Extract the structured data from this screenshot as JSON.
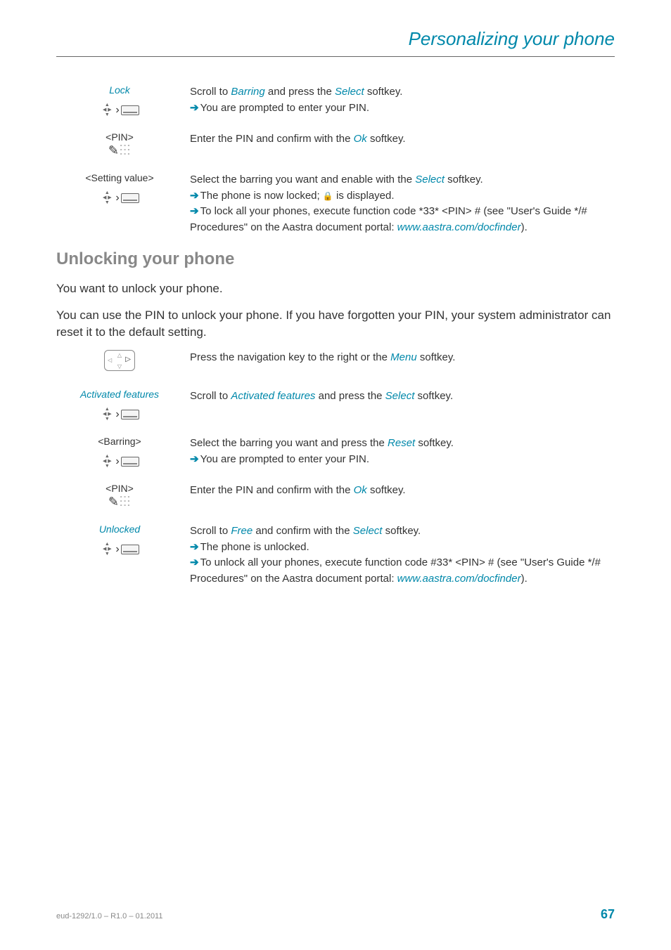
{
  "header": {
    "title": "Personalizing your phone"
  },
  "section1": {
    "steps": [
      {
        "label": "Lock",
        "label_style": "blue",
        "icon": "scroll",
        "lines": [
          {
            "parts": [
              "Scroll to ",
              {
                "t": "Barring",
                "c": "blue"
              },
              " and press the ",
              {
                "t": "Select",
                "c": "blue"
              },
              " softkey."
            ]
          },
          {
            "arrow": true,
            "parts": [
              "You are prompted to enter your PIN."
            ]
          }
        ]
      },
      {
        "label": "<PIN>",
        "label_style": "black",
        "icon": "keypad",
        "lines": [
          {
            "parts": [
              "Enter the PIN and confirm with the ",
              {
                "t": "Ok",
                "c": "blue"
              },
              " softkey."
            ]
          }
        ]
      },
      {
        "label": "<Setting value>",
        "label_style": "black",
        "icon": "scroll",
        "lines": [
          {
            "parts": [
              "Select the barring you want and enable with the ",
              {
                "t": "Select",
                "c": "blue"
              },
              " softkey."
            ]
          },
          {
            "arrow": true,
            "parts": [
              "The phone is now locked; ",
              {
                "t": "lock",
                "c": "glyph"
              },
              " is displayed."
            ]
          },
          {
            "arrow": true,
            "parts": [
              "To lock all your phones, execute function code *33* <PIN> # (see \"User's Guide */# Procedures\" on the Aastra document portal: ",
              {
                "t": "www.aastra.com/docfinder",
                "c": "link"
              },
              ")."
            ]
          }
        ]
      }
    ]
  },
  "section2": {
    "heading": "Unlocking your phone",
    "intro1": "You want to unlock your phone.",
    "intro2": "You can use the PIN to unlock your phone. If you have forgotten your PIN, your system administrator can reset it to the default setting.",
    "steps": [
      {
        "label": "",
        "icon": "navkey",
        "lines": [
          {
            "parts": [
              "Press the navigation key to the right or the ",
              {
                "t": "Menu",
                "c": "blue"
              },
              " softkey."
            ]
          }
        ]
      },
      {
        "label": "Activated features",
        "label_style": "blue",
        "icon": "scroll",
        "lines": [
          {
            "parts": [
              "Scroll to ",
              {
                "t": "Activated features",
                "c": "blue"
              },
              " and press the ",
              {
                "t": "Select",
                "c": "blue"
              },
              " softkey."
            ]
          }
        ]
      },
      {
        "label": "<Barring>",
        "label_style": "black",
        "icon": "scroll",
        "lines": [
          {
            "parts": [
              "Select the barring you want and press the ",
              {
                "t": "Reset",
                "c": "blue"
              },
              " softkey."
            ]
          },
          {
            "arrow": true,
            "parts": [
              "You are prompted to enter your PIN."
            ]
          }
        ]
      },
      {
        "label": "<PIN>",
        "label_style": "black",
        "icon": "keypad",
        "lines": [
          {
            "parts": [
              "Enter the PIN and confirm with the ",
              {
                "t": "Ok",
                "c": "blue"
              },
              " softkey."
            ]
          }
        ]
      },
      {
        "label": "Unlocked",
        "label_style": "blue",
        "icon": "scroll",
        "lines": [
          {
            "parts": [
              "Scroll to ",
              {
                "t": "Free",
                "c": "blue"
              },
              " and confirm with the ",
              {
                "t": "Select",
                "c": "blue"
              },
              " softkey."
            ]
          },
          {
            "arrow": true,
            "parts": [
              "The phone is unlocked."
            ]
          },
          {
            "arrow": true,
            "parts": [
              "To unlock all your phones, execute function code #33* <PIN> # (see \"User's Guide */# Procedures\" on the Aastra document portal: ",
              {
                "t": "www.aastra.com/docfinder",
                "c": "link"
              },
              ")."
            ]
          }
        ]
      }
    ]
  },
  "footer": {
    "left": "eud-1292/1.0 – R1.0 – 01.2011",
    "right": "67"
  }
}
